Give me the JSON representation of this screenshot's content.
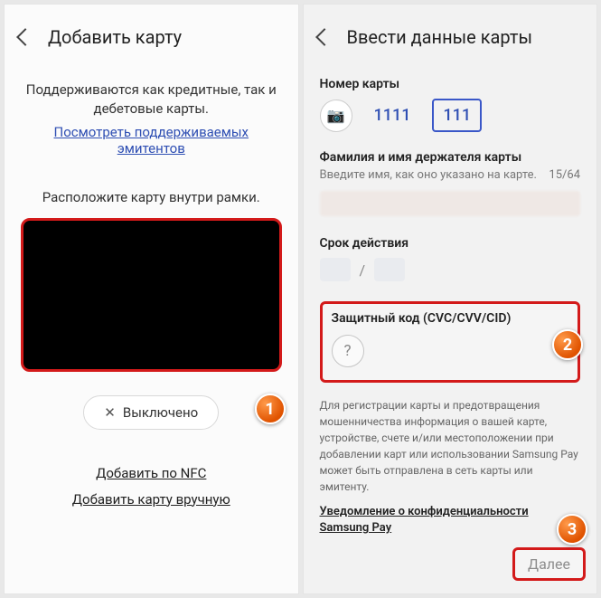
{
  "left": {
    "header": "Добавить карту",
    "support_line1": "Поддерживаются как кредитные, так и",
    "support_line2": "дебетовые карты.",
    "issuers_link_l1": "Посмотреть поддерживаемых",
    "issuers_link_l2": "эмитентов",
    "frame_hint": "Расположите карту внутри рамки.",
    "flash_label": "Выключено",
    "nfc_link": "Добавить по NFC",
    "manual_link": "Добавить карту вручную",
    "badge1": "1"
  },
  "right": {
    "header": "Ввести данные карты",
    "card_number_label": "Номер карты",
    "seg1": "1111",
    "seg2": "111",
    "holder_label": "Фамилия и имя держателя карты",
    "holder_hint": "Введите имя, как оно указано на карте.",
    "counter": "15/64",
    "expiry_label": "Срок действия",
    "expiry_sep": "/",
    "cvc_label": "Защитный код (CVC/CVV/CID)",
    "q_mark": "?",
    "fine_print": "Для регистрации карты и предотвращения мошенничества информация о вашей карте, устройстве, счете и/или местоположении при добавлении карт или использовании Samsung Pay может быть отправлена в сеть карты или эмитенту.",
    "privacy_l1": "Уведомление о конфиденциальности",
    "privacy_l2": "Samsung Pay",
    "next": "Далее",
    "badge2": "2",
    "badge3": "3"
  }
}
